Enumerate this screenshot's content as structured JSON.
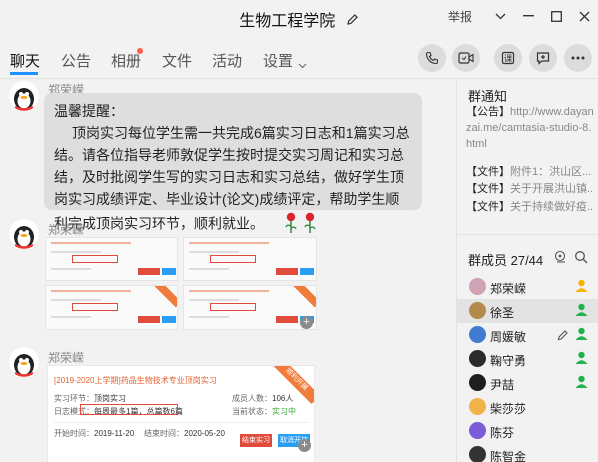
{
  "window": {
    "title": "生物工程学院",
    "report_label": "举报"
  },
  "tabs": [
    {
      "label": "聊天"
    },
    {
      "label": "公告"
    },
    {
      "label": "相册"
    },
    {
      "label": "文件"
    },
    {
      "label": "活动"
    },
    {
      "label": "设置"
    }
  ],
  "toolbar_icons": [
    "phone-icon",
    "video-call-icon",
    "class-icon",
    "add-message-icon",
    "more-icon"
  ],
  "messages": [
    {
      "sender": "郑荣嵘",
      "heading": "温馨提醒：",
      "body": "顶岗实习每位学生需一共完成6篇实习日志和1篇实习总结。请各位指导老师敦促学生按时提交实习周记和实习总结，及时批阅学生写的实习日志和实习总结，做好学生顶岗实习成绩评定、毕业设计(论文)成绩评定，帮助学生顺利完成顶岗实习环节，顺利就业。"
    },
    {
      "sender": "郑荣嵘",
      "tiles": 4
    },
    {
      "sender": "郑荣嵘",
      "card": {
        "title": "[2019-2020上学期]药品生物技术专业顶岗实习",
        "corner": "顺利开展",
        "link_label": "实习环节：",
        "link_value": "顶岗实习",
        "mode_label": "日志模式：",
        "mode_value": "每周最多1篇，总篇数6篇",
        "members_label": "成员人数：",
        "members_value": "106人",
        "status_label": "当前状态：",
        "status_value": "实习中",
        "start_label": "开始时间：",
        "start_value": "2019-11-20",
        "end_label": "结束时间：",
        "end_value": "2020-05-20",
        "btn_end": "结束实习",
        "btn_cancel": "取消开放"
      }
    }
  ],
  "group_notice": {
    "heading": "群通知",
    "announcement_tag": "【公告】",
    "announcement_link": "http://www.dayanzai.me/camtasia-studio-8.html",
    "files": [
      {
        "tag": "【文件】",
        "text": "附件1：洪山区..."
      },
      {
        "tag": "【文件】",
        "text": "关于开展洪山镇..."
      },
      {
        "tag": "【文件】",
        "text": "关于持续做好疫..."
      }
    ]
  },
  "members": {
    "heading": "群成员 27/44",
    "list": [
      {
        "name": "郑荣嵘",
        "role": "owner",
        "color": "#f7b500"
      },
      {
        "name": "徐圣",
        "role": "admin",
        "color": "#22b24c"
      },
      {
        "name": "周媛敏",
        "role": "admin",
        "color": "#22b24c"
      },
      {
        "name": "鞠守勇",
        "role": "admin",
        "color": "#22b24c"
      },
      {
        "name": "尹喆",
        "role": "admin",
        "color": "#22b24c"
      },
      {
        "name": "柴莎莎",
        "role": "",
        "color": ""
      },
      {
        "name": "陈芬",
        "role": "",
        "color": ""
      },
      {
        "name": "陈智金",
        "role": "",
        "color": ""
      }
    ]
  },
  "colors": {
    "accent": "#1e90ff",
    "bubble": "#dedede",
    "owner_badge": "#f7b500",
    "admin_badge": "#22b24c",
    "card_title": "#e0622e"
  }
}
